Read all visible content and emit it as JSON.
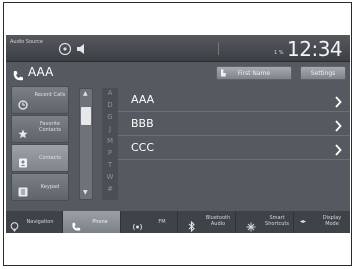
{
  "status_bar": {
    "audio_source_label": "Audio Source",
    "signal_label": "1 %",
    "clock": "12:34"
  },
  "header": {
    "title": "AAA",
    "first_name_button": "First Name",
    "settings_button": "Settings"
  },
  "menu": {
    "items": [
      {
        "label": "Recent Calls",
        "icon": "clock-icon"
      },
      {
        "label": "Favorite Contacts",
        "icon": "star-icon"
      },
      {
        "label": "Contacts",
        "icon": "contacts-icon"
      },
      {
        "label": "Keypad",
        "icon": "keypad-icon"
      }
    ],
    "active_index": 2
  },
  "alphabet": [
    "A",
    "D",
    "G",
    "J",
    "M",
    "P",
    "T",
    "W",
    "#"
  ],
  "contacts": [
    {
      "name": "AAA"
    },
    {
      "name": "BBB"
    },
    {
      "name": "CCC"
    }
  ],
  "bottom_nav": {
    "items": [
      {
        "label": "Navigation"
      },
      {
        "label": "Phone"
      },
      {
        "label": "FM"
      },
      {
        "label": "Bluetooth Audio"
      },
      {
        "label": "Smart Shortcuts"
      },
      {
        "label": "Display Mode"
      }
    ],
    "active_index": 1
  },
  "colors": {
    "screen_bg": "#555a60",
    "active_tab": "#8e9399",
    "text": "#ffffff"
  }
}
